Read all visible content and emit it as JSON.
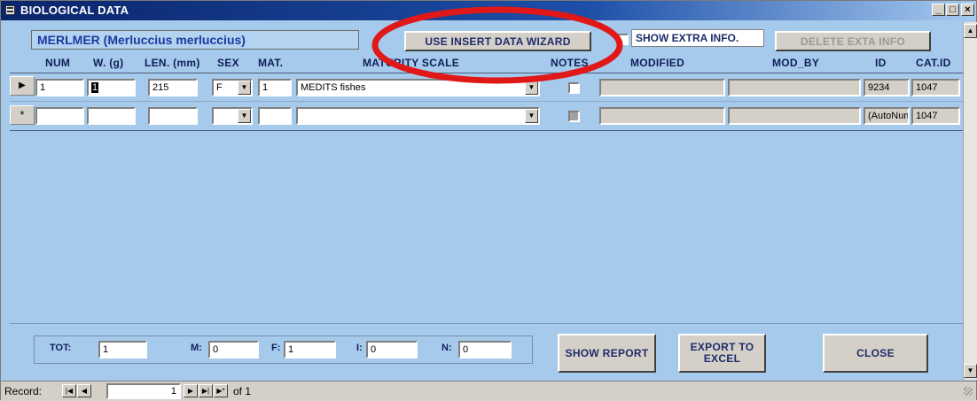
{
  "window": {
    "title": "BIOLOGICAL DATA"
  },
  "species": {
    "label": "MERLMER (Merluccius merluccius)"
  },
  "toolbar": {
    "wizard_label": "USE INSERT DATA WIZARD",
    "show_extra_label": "SHOW EXTRA INFO.",
    "delete_extra_label": "DELETE EXTA INFO"
  },
  "columns": {
    "num": "NUM",
    "weight": "W. (g)",
    "length": "LEN. (mm)",
    "sex": "SEX",
    "mat": "MAT.",
    "maturity": "MATURITY SCALE",
    "notes": "NOTES",
    "modified": "MODIFIED",
    "mod_by": "MOD_BY",
    "id": "ID",
    "cat_id": "CAT.ID"
  },
  "rows": [
    {
      "num": "1",
      "weight": "1",
      "length": "215",
      "sex": "F",
      "mat": "1",
      "maturity": "MEDITS fishes",
      "notes": false,
      "modified": "",
      "mod_by": "",
      "id": "9234",
      "cat_id": "1047"
    },
    {
      "num": "",
      "weight": "",
      "length": "",
      "sex": "",
      "mat": "",
      "maturity": "",
      "notes": null,
      "modified": "",
      "mod_by": "",
      "id": "(AutoNum",
      "cat_id": "1047"
    }
  ],
  "row_selectors": {
    "current": "▶",
    "new": "*"
  },
  "totals": {
    "tot_label": "TOT:",
    "tot": "1",
    "m_label": "M:",
    "m": "0",
    "f_label": "F:",
    "f": "1",
    "i_label": "I:",
    "i": "0",
    "n_label": "N:",
    "n": "0"
  },
  "actions": {
    "show_report": "SHOW REPORT",
    "export_excel_1": "EXPORT TO",
    "export_excel_2": "EXCEL",
    "close": "CLOSE"
  },
  "record_nav": {
    "label": "Record:",
    "current": "1",
    "of_label": "of 1"
  },
  "colors": {
    "background": "#a6caec",
    "title_bar": "#0a246a",
    "label_text": "#0f1e58",
    "highlight_ring": "#e01818"
  }
}
